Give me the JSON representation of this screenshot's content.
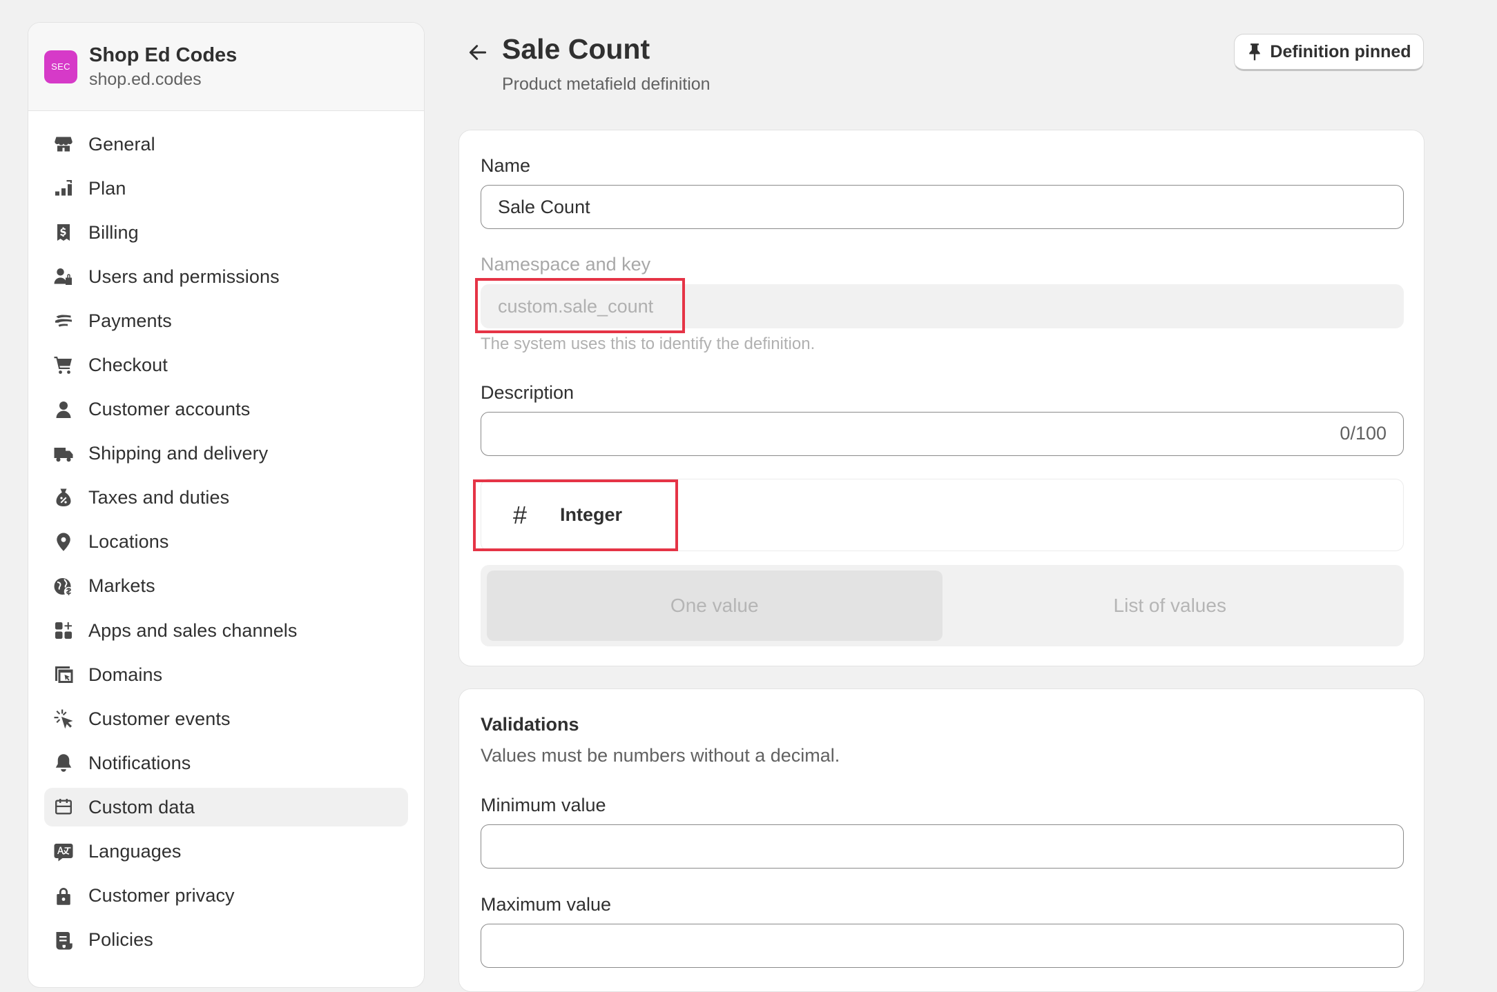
{
  "store": {
    "badge": "SEC",
    "name": "Shop Ed Codes",
    "url": "shop.ed.codes",
    "badge_color": "#d63ac8"
  },
  "sidebar": {
    "active_index": 15,
    "items": [
      {
        "label": "General",
        "icon": "store-icon"
      },
      {
        "label": "Plan",
        "icon": "plan-icon"
      },
      {
        "label": "Billing",
        "icon": "billing-icon"
      },
      {
        "label": "Users and permissions",
        "icon": "users-icon"
      },
      {
        "label": "Payments",
        "icon": "payments-icon"
      },
      {
        "label": "Checkout",
        "icon": "cart-icon"
      },
      {
        "label": "Customer accounts",
        "icon": "person-icon"
      },
      {
        "label": "Shipping and delivery",
        "icon": "truck-icon"
      },
      {
        "label": "Taxes and duties",
        "icon": "tax-icon"
      },
      {
        "label": "Locations",
        "icon": "location-icon"
      },
      {
        "label": "Markets",
        "icon": "globe-icon"
      },
      {
        "label": "Apps and sales channels",
        "icon": "apps-icon"
      },
      {
        "label": "Domains",
        "icon": "domains-icon"
      },
      {
        "label": "Customer events",
        "icon": "cursor-icon"
      },
      {
        "label": "Notifications",
        "icon": "bell-icon"
      },
      {
        "label": "Custom data",
        "icon": "custom-data-icon"
      },
      {
        "label": "Languages",
        "icon": "language-icon"
      },
      {
        "label": "Customer privacy",
        "icon": "lock-icon"
      },
      {
        "label": "Policies",
        "icon": "policies-icon"
      }
    ]
  },
  "header": {
    "title": "Sale Count",
    "subtitle": "Product metafield definition",
    "pin_label": "Definition pinned"
  },
  "definition": {
    "name_label": "Name",
    "name_value": "Sale Count",
    "namespace_label": "Namespace and key",
    "namespace_value": "custom.sale_count",
    "namespace_help": "The system uses this to identify the definition.",
    "description_label": "Description",
    "description_value": "",
    "description_count": "0/100",
    "type_symbol": "#",
    "type_label": "Integer",
    "value_options": [
      "One value",
      "List of values"
    ],
    "selected_option": "One value"
  },
  "validations": {
    "title": "Validations",
    "description": "Values must be numbers without a decimal.",
    "min_label": "Minimum value",
    "min_value": "",
    "max_label": "Maximum value",
    "max_value": ""
  },
  "colors": {
    "highlight": "#e53446",
    "page_bg": "#f1f1f1"
  }
}
